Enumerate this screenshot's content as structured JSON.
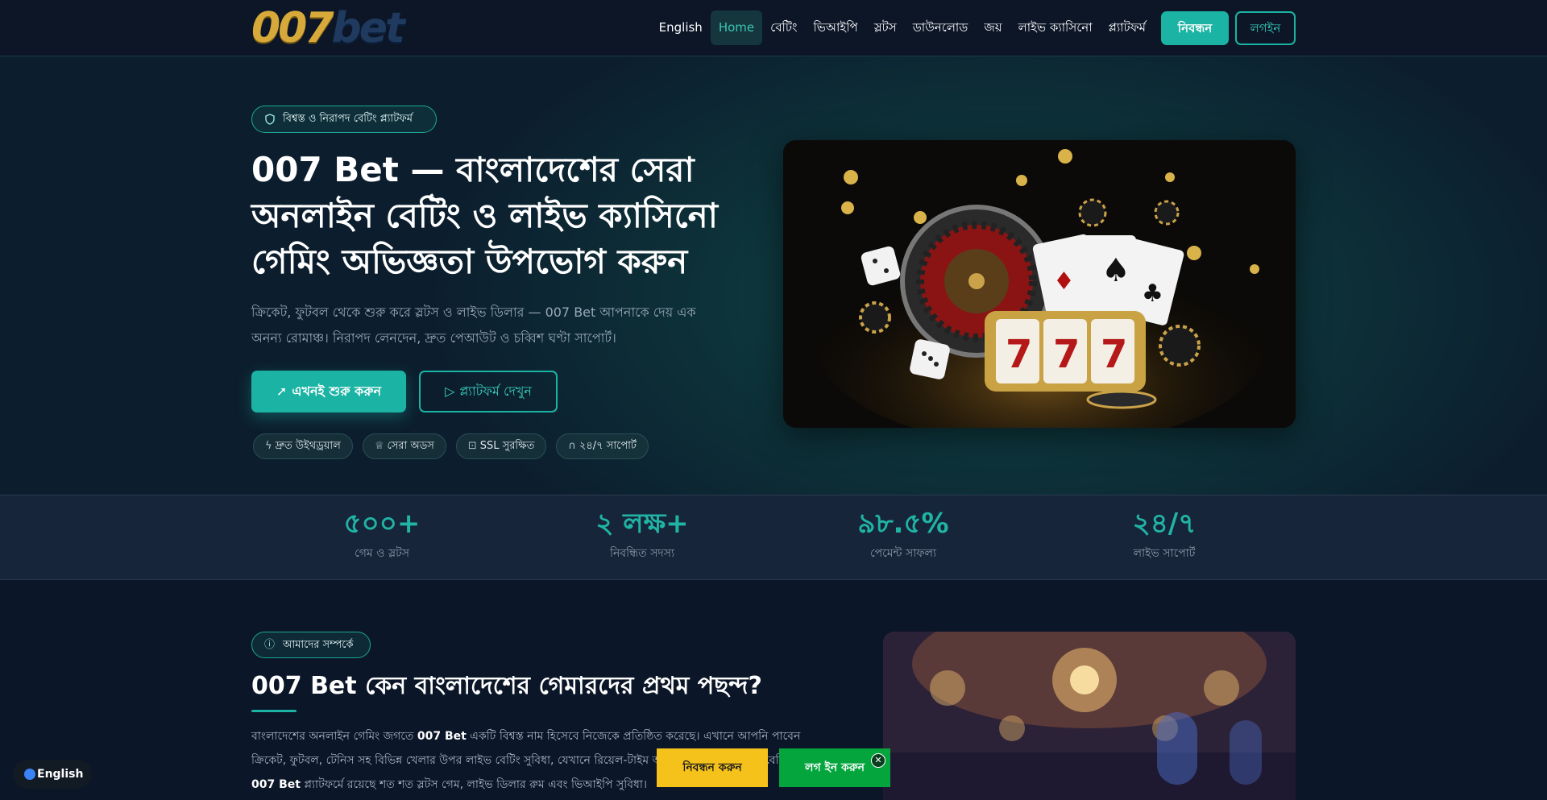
{
  "nav": {
    "logo_part1": "007",
    "logo_part2": "bet",
    "links": [
      "English",
      "Home",
      "বেটিং",
      "ভিআইপি",
      "স্লটস",
      "ডাউনলোড",
      "জয়",
      "লাইভ ক্যাসিনো",
      "প্ল্যাটফর্ম"
    ],
    "register": "নিবন্ধন",
    "login": "লগইন"
  },
  "hero": {
    "badge": "বিশ্বস্ত ও নিরাপদ বেটিং প্ল্যাটফর্ম",
    "title": "007 Bet — বাংলাদেশের সেরা অনলাইন বেটিং ও লাইভ ক্যাসিনো গেমিং অভিজ্ঞতা উপভোগ করুন",
    "subtitle": "ক্রিকেট, ফুটবল থেকে শুরু করে স্লটস ও লাইভ ডিলার — 007 Bet আপনাকে দেয় এক অনন্য রোমাঞ্চ। নিরাপদ লেনদেন, দ্রুত পেআউট ও চব্বিশ ঘণ্টা সাপোর্ট।",
    "cta_primary": "এখনই শুরু করুন",
    "cta_secondary": "প্ল্যাটফর্ম দেখুন",
    "chips": [
      {
        "icon": "bolt-icon",
        "label": "দ্রুত উইথড্রয়াল"
      },
      {
        "icon": "trophy-icon",
        "label": "সেরা অডস"
      },
      {
        "icon": "lock-icon",
        "label": "SSL সুরক্ষিত"
      },
      {
        "icon": "headset-icon",
        "label": "২৪/৭ সাপোর্ট"
      }
    ]
  },
  "stats": [
    {
      "value": "৫০০+",
      "label": "গেম ও স্লটস"
    },
    {
      "value": "২ লক্ষ+",
      "label": "নিবন্ধিত সদস্য"
    },
    {
      "value": "৯৮.৫%",
      "label": "পেমেন্ট সাফল্য"
    },
    {
      "value": "২৪/৭",
      "label": "লাইভ সাপোর্ট"
    }
  ],
  "about": {
    "badge": "আমাদের সম্পর্কে",
    "title": "007 Bet কেন বাংলাদেশের গেমারদের প্রথম পছন্দ?",
    "text_1": "বাংলাদেশের অনলাইন গেমিং জগতে ",
    "brand": "007 Bet",
    "text_2": " একটি বিশ্বস্ত নাম হিসেবে নিজেকে প্রতিষ্ঠিত করেছে। এখানে আপনি পাবেন ক্রিকেট, ফুটবল, টেনিস সহ বিভিন্ন খেলার উপর লাইভ বেটিং সুবিধা, যেখানে রিয়েল-টাইম অডস আপডেট হয়। শুধু বেটিং নয়, ",
    "brand_2": "007 Bet",
    "text_3": " প্ল্যাটফর্মে রয়েছে শত শত স্লটস গেম, লাইভ ডিলার রুম এবং ভিআইপি সুবিধা।"
  },
  "floating": {
    "language": "English",
    "sticky_register": "নিবন্ধন করুন",
    "sticky_login": "লগ ইন করুন"
  },
  "colors": {
    "accent": "#1bb3a3",
    "background": "#0b1628",
    "sticky_register": "#f5c21b",
    "sticky_login": "#05a53e"
  }
}
